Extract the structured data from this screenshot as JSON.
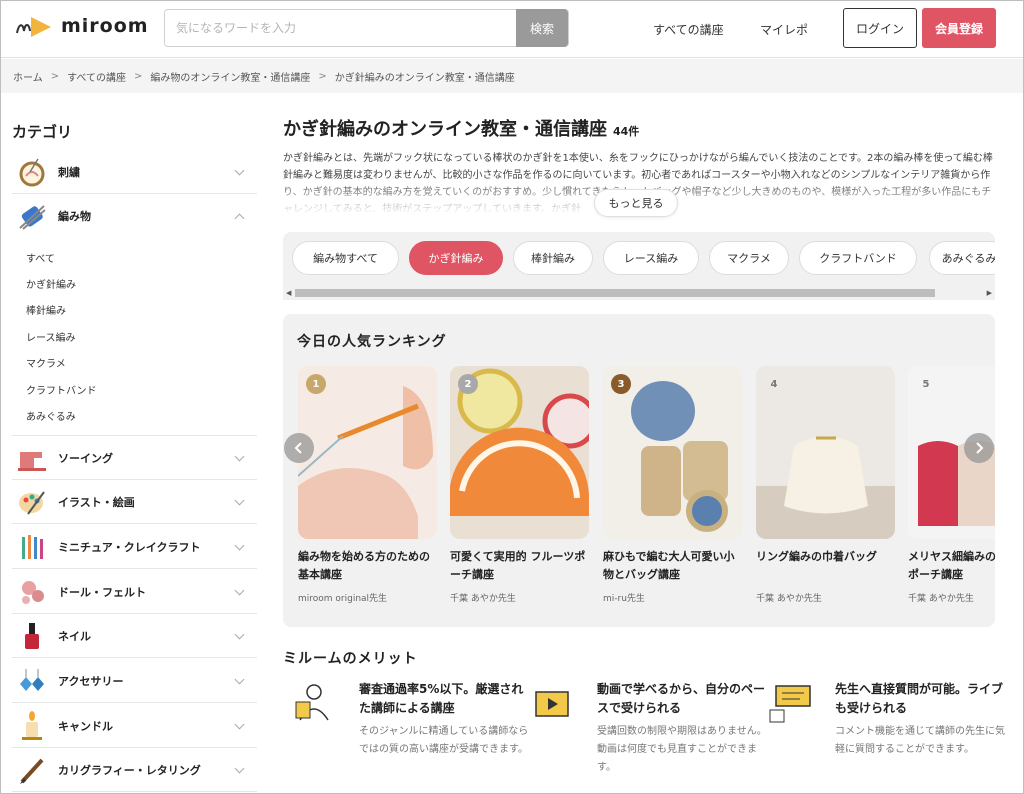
{
  "header": {
    "logo_text": "miroom",
    "search_placeholder": "気になるワードを入力",
    "search_button": "検索",
    "nav_all_courses": "すべての講座",
    "nav_my_report": "マイレポ",
    "login": "ログイン",
    "signup": "会員登録",
    "accent_color": "#e05564"
  },
  "breadcrumb": [
    "ホーム",
    "すべての講座",
    "編み物のオンライン教室・通信講座",
    "かぎ針編みのオンライン教室・通信講座"
  ],
  "sidebar": {
    "title": "カテゴリ",
    "categories": [
      {
        "label": "刺繍",
        "icon": "embroidery-hoop-icon",
        "expanded": false
      },
      {
        "label": "編み物",
        "icon": "yarn-knitting-icon",
        "expanded": true
      },
      {
        "label": "ソーイング",
        "icon": "sewing-machine-icon",
        "expanded": false
      },
      {
        "label": "イラスト・絵画",
        "icon": "paint-palette-icon",
        "expanded": false
      },
      {
        "label": "ミニチュア・クレイクラフト",
        "icon": "craft-tools-icon",
        "expanded": false
      },
      {
        "label": "ドール・フェルト",
        "icon": "felt-doll-icon",
        "expanded": false
      },
      {
        "label": "ネイル",
        "icon": "nail-polish-icon",
        "expanded": false
      },
      {
        "label": "アクセサリー",
        "icon": "earrings-icon",
        "expanded": false
      },
      {
        "label": "キャンドル",
        "icon": "candle-icon",
        "expanded": false
      },
      {
        "label": "カリグラフィー・レタリング",
        "icon": "calligraphy-pen-icon",
        "expanded": false
      }
    ],
    "subitems": [
      "すべて",
      "かぎ針編み",
      "棒針編み",
      "レース編み",
      "マクラメ",
      "クラフトバンド",
      "あみぐるみ"
    ]
  },
  "main": {
    "title": "かぎ針編みのオンライン教室・通信講座",
    "count": "44件",
    "description": "かぎ針編みとは、先端がフック状になっている棒状のかぎ針を1本使い、糸をフックにひっかけながら編んでいく技法のことです。2本の編み棒を使って編む棒針編みと難易度は変わりませんが、比較的小さな作品を作るのに向いています。初心者であればコースターや小物入れなどのシンプルなインテリア雑貨から作り、かぎ針の基本的な編み方を覚えていくのがおすすめ。少し慣れてきたらトートバッグや帽子など少し大きめのものや、模様が入った工程が多い作品にもチャレンジしてみると、技術がステップアップしていきます。かぎ針",
    "more_button": "もっと見る",
    "tabs": [
      "編み物すべて",
      "かぎ針編み",
      "棒針編み",
      "レース編み",
      "マクラメ",
      "クラフトバンド",
      "あみぐるみ"
    ],
    "active_tab": "かぎ針編み"
  },
  "ranking": {
    "title": "今日の人気ランキング",
    "cards": [
      {
        "rank": "1",
        "title": "編み物を始める方のための基本講座",
        "teacher": "miroom original先生",
        "badge_color": "#c8a86a"
      },
      {
        "rank": "2",
        "title": "可愛くて実用的 フルーツポーチ講座",
        "teacher": "千葉 あやか先生",
        "badge_color": "#a8a8a8"
      },
      {
        "rank": "3",
        "title": "麻ひもで編む大人可愛い小物とバッグ講座",
        "teacher": "mi-ru先生",
        "badge_color": "#8b5a2b"
      },
      {
        "rank": "4",
        "title": "リング編みの巾着バッグ",
        "teacher": "千葉 あやか先生",
        "badge_color": "#cfcfcf"
      },
      {
        "rank": "5",
        "title": "メリヤス細編みのポーチ講座",
        "teacher": "千葉 あやか先生",
        "badge_color": "#cfcfcf"
      }
    ]
  },
  "merits": {
    "title": "ミルームのメリット",
    "items": [
      {
        "heading": "審査通過率5%以下。厳選された講師による講座",
        "body": "そのジャンルに精通している講師ならではの質の高い講座が受講できます。",
        "icon": "teacher-icon"
      },
      {
        "heading": "動画で学べるから、自分のペースで受けられる",
        "body": "受講回数の制限や期限はありません。動画は何度でも見直すことができます。",
        "icon": "video-play-icon"
      },
      {
        "heading": "先生へ直接質問が可能。ライブも受けられる",
        "body": "コメント機能を通じて講師の先生に気軽に質問することができます。",
        "icon": "chat-question-icon"
      }
    ]
  }
}
